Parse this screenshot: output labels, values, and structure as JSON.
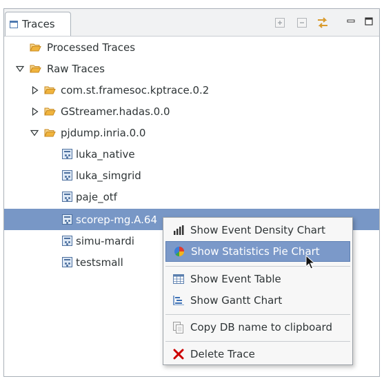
{
  "view": {
    "tab_title": "Traces",
    "toolbar": {
      "icons": [
        "expand-all-icon",
        "collapse-all-icon",
        "link-with-editor-icon",
        "minimize-icon",
        "maximize-icon"
      ]
    }
  },
  "tree": {
    "processed": "Processed Traces",
    "raw": "Raw Traces",
    "groups": {
      "kptrace": "com.st.framesoc.kptrace.0.2",
      "gstreamer": "GStreamer.hadas.0.0",
      "pjdump": "pjdump.inria.0.0"
    },
    "traces": {
      "luka_native": "luka_native",
      "luka_simgrid": "luka_simgrid",
      "paje_otf": "paje_otf",
      "scorep": "scorep-mg.A.64",
      "simu_mardi": "simu-mardi",
      "testsmall": "testsmall"
    }
  },
  "context_menu": {
    "event_density": "Show Event Density Chart",
    "statistics_pie": "Show Statistics Pie Chart",
    "event_table": "Show Event Table",
    "gantt": "Show Gantt Chart",
    "copy_db": "Copy DB name to clipboard",
    "delete": "Delete Trace"
  },
  "colors": {
    "selection": "#7897c6",
    "menu_hover": "#7b99c9",
    "folder": "#e8a33c",
    "delete": "#cc0000"
  }
}
